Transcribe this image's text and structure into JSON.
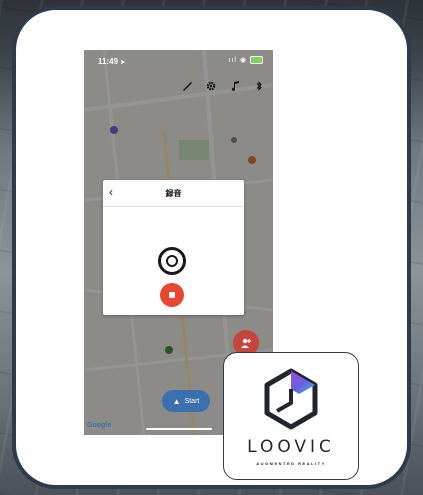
{
  "status_bar": {
    "time": "11:49",
    "location_arrow": "➤",
    "signal": "ııl",
    "wifi": "◉"
  },
  "toolbar": {
    "icons": [
      "brush-icon",
      "gear-icon",
      "music-note-icon",
      "bluetooth-icon"
    ]
  },
  "modal": {
    "title": "録音",
    "back": "‹"
  },
  "map": {
    "provider": "Google"
  },
  "start_button": {
    "label": "Start",
    "arrow": "▲"
  },
  "fab": {
    "icon": "person-add-icon"
  },
  "logo": {
    "brand": "LOOVIC",
    "tagline": "AUGMENTED REALITY"
  },
  "colors": {
    "frame": "#2e3b4c",
    "stop": "#e9452f",
    "start": "#3b6fae",
    "fab": "#c7443a"
  }
}
